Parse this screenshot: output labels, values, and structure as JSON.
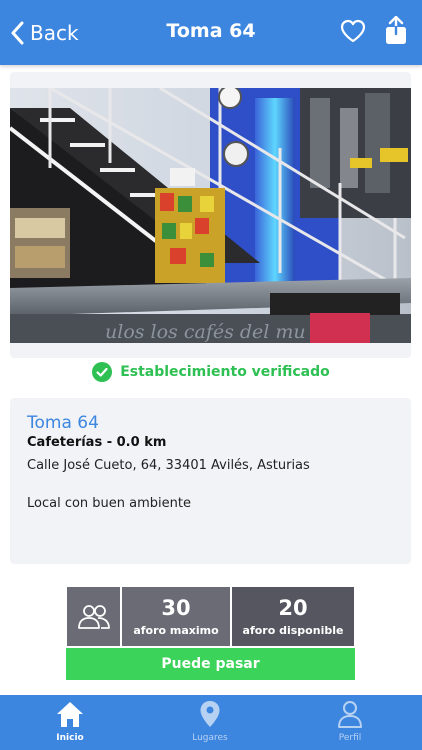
{
  "header": {
    "back_label": "Back",
    "title": "Toma 64",
    "favorite_icon": "heart-outline-icon",
    "share_icon": "share-icon"
  },
  "photo": {
    "wall_text": "ulos los cafés del mu"
  },
  "verification": {
    "label": "Establecimiento verificado",
    "icon": "check-circle-icon",
    "color": "#2ec052"
  },
  "place": {
    "name": "Toma 64",
    "category_distance": "Cafeterías - 0.0 km",
    "address": "Calle José Cueto, 64, 33401 Avilés, Asturias",
    "description": "Local con buen ambiente"
  },
  "capacity": {
    "icon": "people-icon",
    "max_value": "30",
    "max_label": "aforo maximo",
    "available_value": "20",
    "available_label": "aforo disponible"
  },
  "action": {
    "label": "Puede pasar",
    "color": "#3cd35a"
  },
  "tabbar": {
    "tabs": [
      {
        "label": "Inicio",
        "icon": "home-icon",
        "active": true
      },
      {
        "label": "Lugares",
        "icon": "location-pin-icon",
        "active": false
      },
      {
        "label": "Perfil",
        "icon": "user-icon",
        "active": false
      }
    ]
  },
  "colors": {
    "primary": "#3d86e0",
    "card_bg": "#f1f3f7",
    "stat_bg": "#6b6b75"
  }
}
